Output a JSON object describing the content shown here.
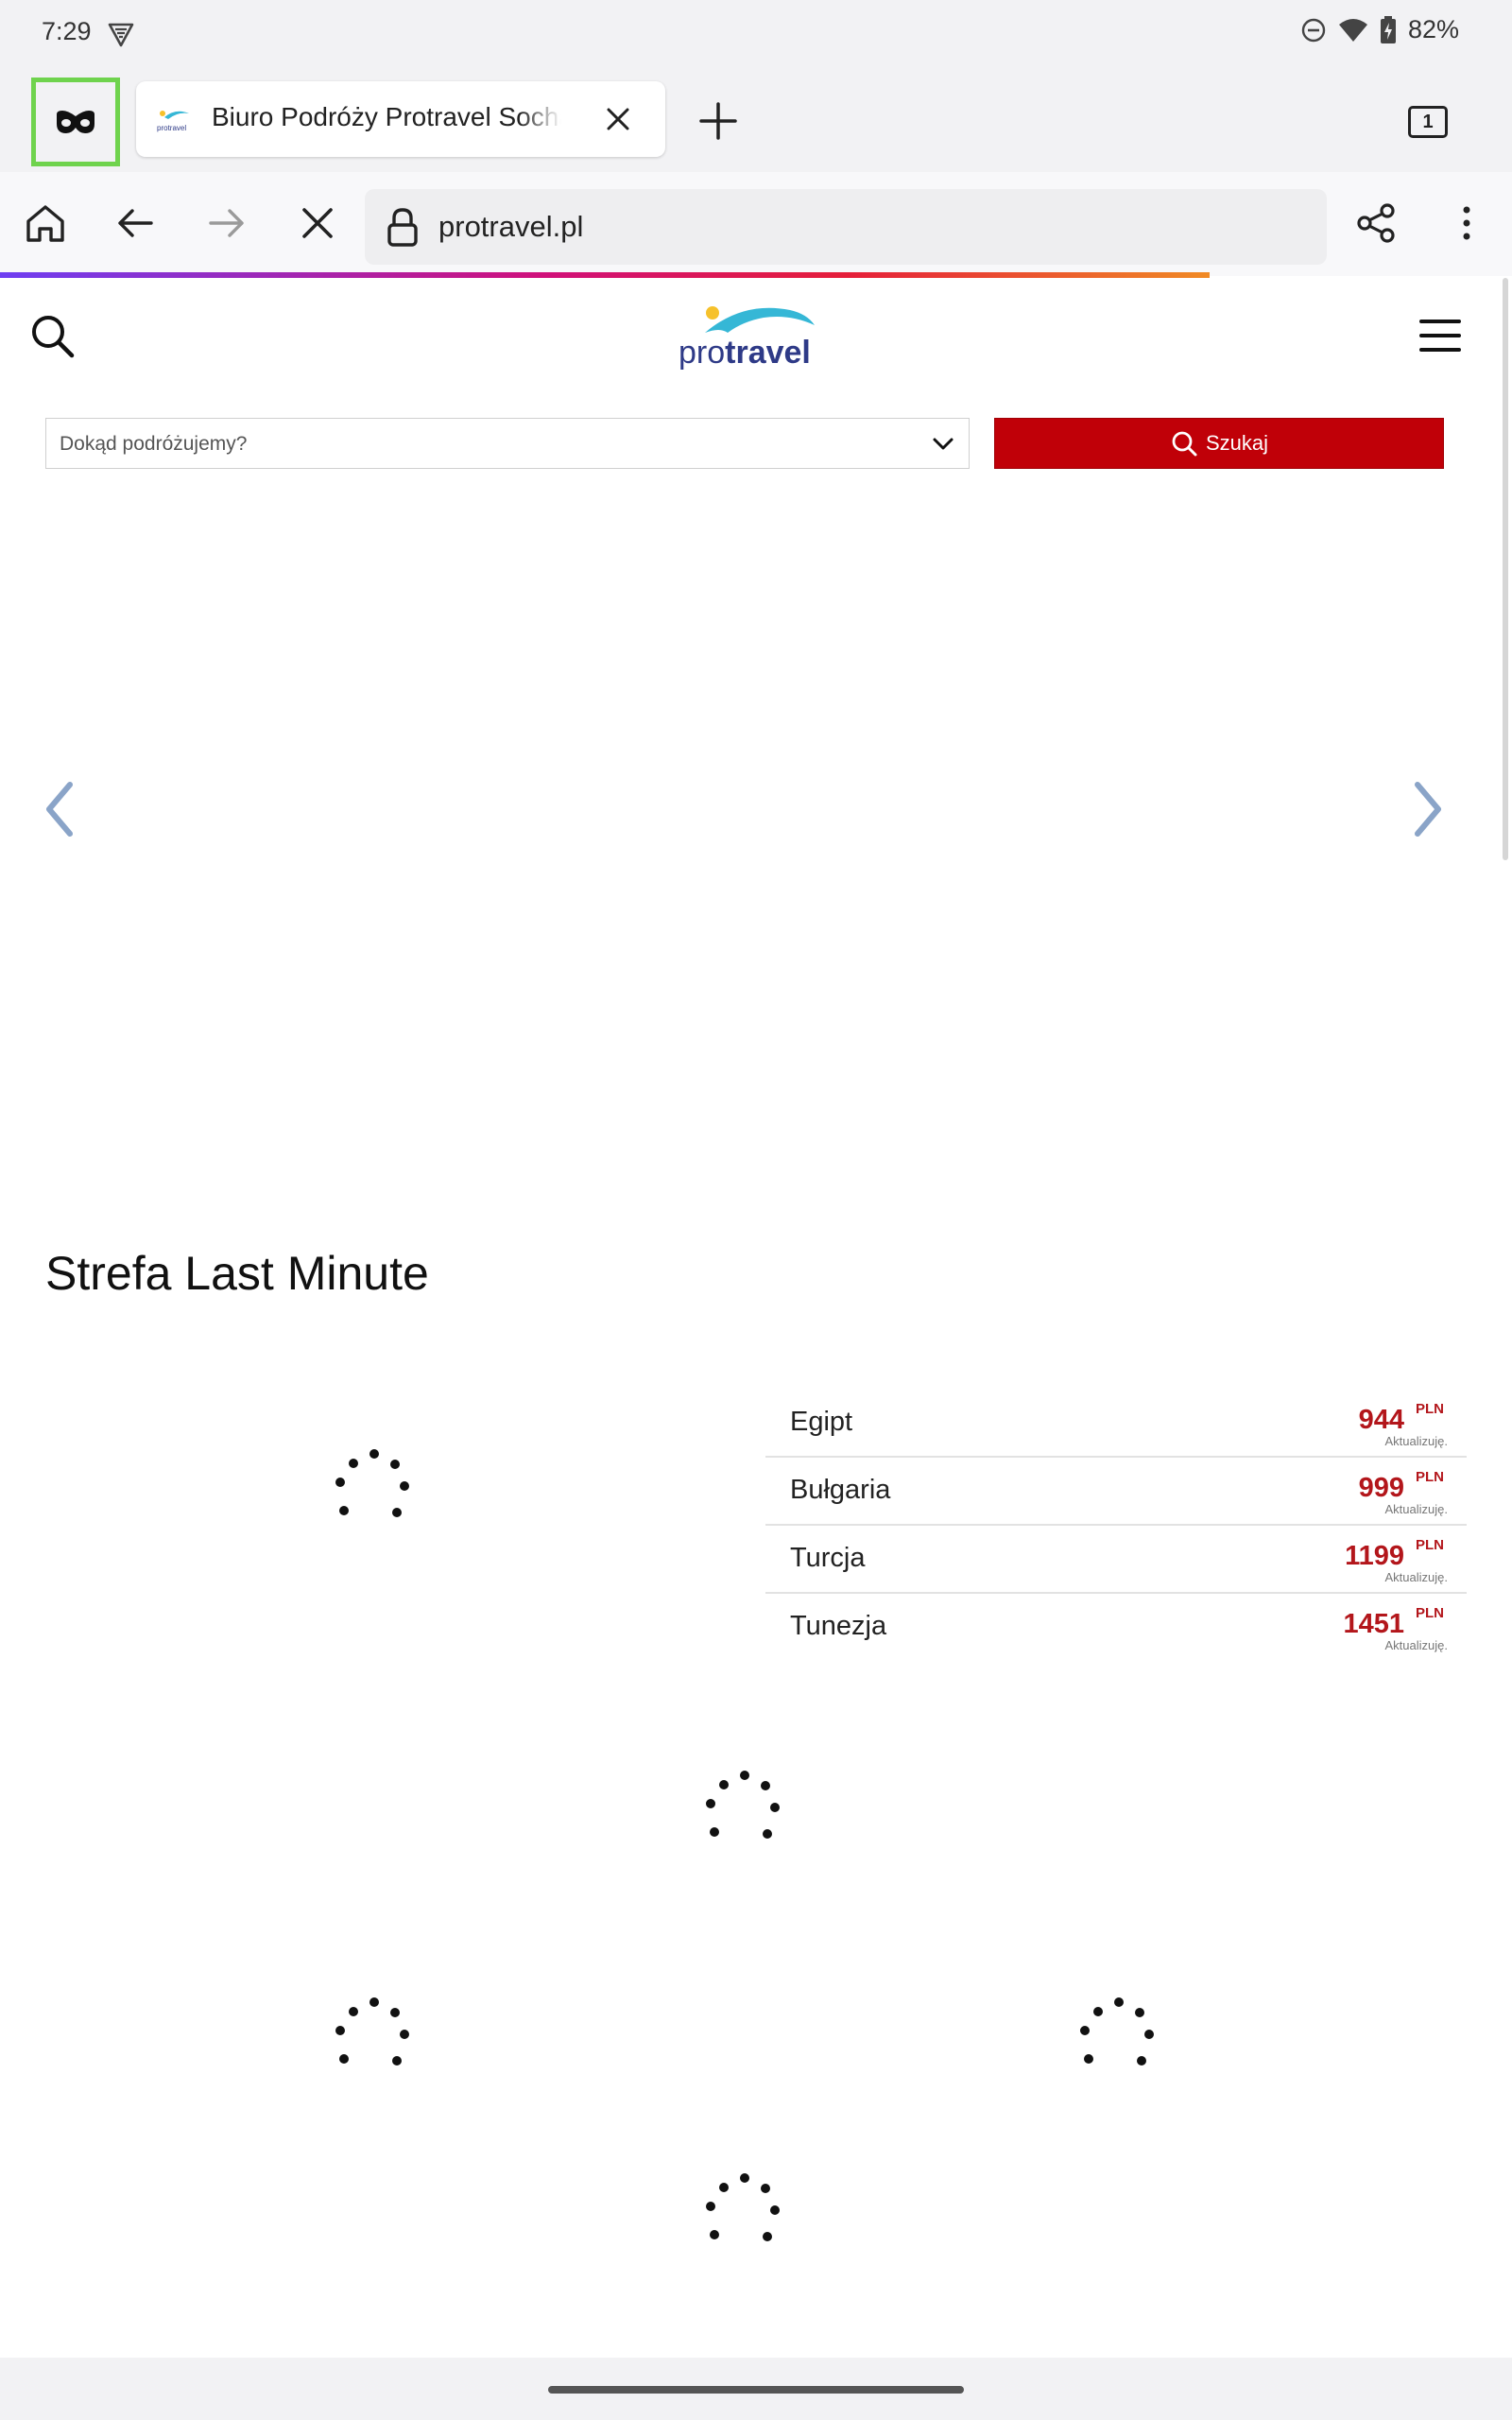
{
  "status_bar": {
    "time": "7:29",
    "battery": "82%",
    "icons": [
      "vpn-shield-icon",
      "do-not-disturb-icon",
      "wifi-icon",
      "battery-charging-icon"
    ]
  },
  "browser": {
    "incognito_icon": "incognito-mask-icon",
    "tab": {
      "title": "Biuro Podróży Protravel Sochaczew",
      "favicon": "protravel-favicon"
    },
    "tab_count": "1",
    "url": "protravel.pl",
    "load_progress_fraction": 0.8,
    "toolbar_icons": [
      "home-icon",
      "back-icon",
      "forward-icon",
      "stop-icon",
      "lock-icon",
      "share-icon",
      "more-icon"
    ]
  },
  "site": {
    "logo": {
      "light": "pro",
      "bold": "travel"
    },
    "search": {
      "placeholder": "Dokąd podróżujemy?",
      "button_label": "Szukaj"
    },
    "section_title": "Strefa Last Minute",
    "last_minute": [
      {
        "country": "Egipt",
        "price": "944",
        "currency": "PLN",
        "note": "Aktualizuję."
      },
      {
        "country": "Bułgaria",
        "price": "999",
        "currency": "PLN",
        "note": "Aktualizuję."
      },
      {
        "country": "Turcja",
        "price": "1199",
        "currency": "PLN",
        "note": "Aktualizuję."
      },
      {
        "country": "Tunezja",
        "price": "1451",
        "currency": "PLN",
        "note": "Aktualizuję."
      }
    ]
  },
  "colors": {
    "accent_red": "#c00008",
    "price_red": "#b3161b",
    "logo_blue": "#2e3a87",
    "logo_cyan": "#35b7d6",
    "logo_yellow": "#f6c12b",
    "incognito_highlight": "#6fd34d"
  }
}
